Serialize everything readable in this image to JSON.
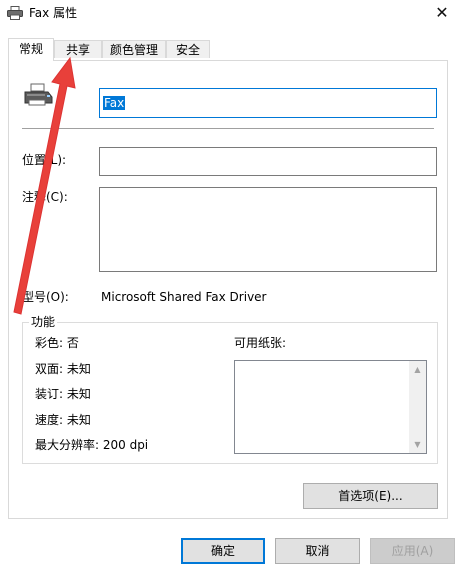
{
  "window": {
    "title": "Fax 属性",
    "close_symbol": "✕"
  },
  "tabs": [
    {
      "label": "常规",
      "active": true
    },
    {
      "label": "共享",
      "active": false
    },
    {
      "label": "颜色管理",
      "active": false
    },
    {
      "label": "安全",
      "active": false
    }
  ],
  "general": {
    "printer_name_value": "Fax",
    "location_label": "位置(L):",
    "location_value": "",
    "comment_label": "注释(C):",
    "comment_value": "",
    "model_label": "型号(O):",
    "model_value": "Microsoft Shared Fax Driver"
  },
  "features": {
    "group_title": "功能",
    "color": "彩色: 否",
    "duplex": "双面: 未知",
    "staple": "装订: 未知",
    "speed": "速度: 未知",
    "resolution": "最大分辨率: 200 dpi",
    "paper_label": "可用纸张:",
    "paper_items": []
  },
  "buttons": {
    "preferences": "首选项(E)...",
    "ok": "确定",
    "cancel": "取消",
    "apply": "应用(A)"
  },
  "colors": {
    "accent": "#0078d7",
    "annotation_arrow": "#e8403a"
  },
  "icons": {
    "title_icon": "printer-icon",
    "general_icon": "fax-printer-icon"
  }
}
